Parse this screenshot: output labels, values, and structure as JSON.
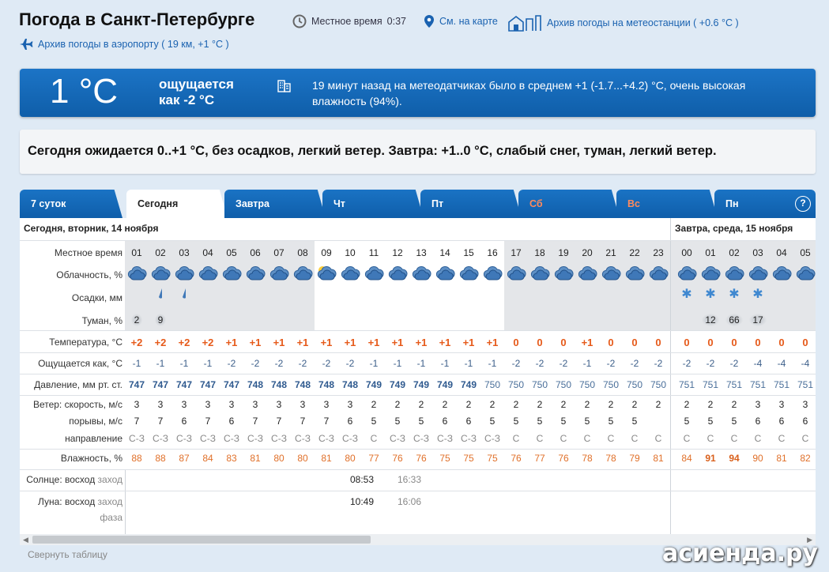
{
  "header": {
    "title": "Погода в Санкт-Петербурге",
    "local_time_label": "Местное время",
    "local_time_value": "0:37",
    "map_link": "См. на карте",
    "station_archive": "Архив погоды на метеостанции ( +0.6 °C )",
    "airport_archive": "Архив погоды в аэропорту ( 19 км, +1 °C )"
  },
  "current": {
    "temp": "1 °C",
    "feels_line1": "ощущается",
    "feels_line2": "как -2 °C",
    "desc": "19 минут назад на метеодатчиках было в среднем +1 (-1.7...+4.2) °C, очень высокая влажность (94%)."
  },
  "forecast_text": "Сегодня ожидается 0..+1 °C, без осадков, легкий ветер. Завтра: +1..0 °C, слабый снег, туман, легкий ветер.",
  "tabs": [
    {
      "label": "7 суток"
    },
    {
      "label": "Сегодня"
    },
    {
      "label": "Завтра"
    },
    {
      "label": "Чт"
    },
    {
      "label": "Пт"
    },
    {
      "label": "Сб"
    },
    {
      "label": "Вс"
    },
    {
      "label": "Пн"
    }
  ],
  "help": "?",
  "table": {
    "day1": "Сегодня, вторник, 14 ноября",
    "day2": "Завтра, среда, 15 ноября",
    "labels": {
      "time": "Местное время",
      "cloud": "Облачность, %",
      "precip": "Осадки, мм",
      "fog": "Туман, %",
      "temp": "Температура, °С",
      "feels": "Ощущается как, °С",
      "pressure": "Давление, мм рт. ст.",
      "wind": "Ветер: скорость, м/с",
      "gusts": "порывы, м/с",
      "direction": "направление",
      "humidity": "Влажность, %",
      "sun": "Солнце:",
      "sunrise": "восход",
      "sunset": "заход",
      "moon": "Луна:",
      "phase": "фаза"
    },
    "hours": [
      "01",
      "02",
      "03",
      "04",
      "05",
      "06",
      "07",
      "08",
      "09",
      "10",
      "11",
      "12",
      "13",
      "14",
      "15",
      "16",
      "17",
      "18",
      "19",
      "20",
      "21",
      "22",
      "23",
      "00",
      "01",
      "02",
      "03",
      "04",
      "05"
    ],
    "fog": [
      "2",
      "9",
      "",
      "",
      "",
      "",
      "",
      "",
      "",
      "",
      "",
      "",
      "",
      "",
      "",
      "",
      "",
      "",
      "",
      "",
      "",
      "",
      "",
      "",
      "12",
      "66",
      "17",
      "",
      ""
    ],
    "temp": [
      "+2",
      "+2",
      "+2",
      "+2",
      "+1",
      "+1",
      "+1",
      "+1",
      "+1",
      "+1",
      "+1",
      "+1",
      "+1",
      "+1",
      "+1",
      "+1",
      "0",
      "0",
      "0",
      "+1",
      "0",
      "0",
      "0",
      "0",
      "0",
      "0",
      "0",
      "0",
      "0"
    ],
    "feels": [
      "-1",
      "-1",
      "-1",
      "-1",
      "-2",
      "-2",
      "-2",
      "-2",
      "-2",
      "-2",
      "-1",
      "-1",
      "-1",
      "-1",
      "-1",
      "-1",
      "-2",
      "-2",
      "-2",
      "-1",
      "-2",
      "-2",
      "-2",
      "-2",
      "-2",
      "-2",
      "-4",
      "-4",
      "-4"
    ],
    "pressure": [
      "747",
      "747",
      "747",
      "747",
      "747",
      "748",
      "748",
      "748",
      "748",
      "748",
      "749",
      "749",
      "749",
      "749",
      "749",
      "750",
      "750",
      "750",
      "750",
      "750",
      "750",
      "750",
      "750",
      "751",
      "751",
      "751",
      "751",
      "751",
      "751"
    ],
    "wind": [
      "3",
      "3",
      "3",
      "3",
      "3",
      "3",
      "3",
      "3",
      "3",
      "3",
      "2",
      "2",
      "2",
      "2",
      "2",
      "2",
      "2",
      "2",
      "2",
      "2",
      "2",
      "2",
      "2",
      "2",
      "2",
      "2",
      "3",
      "3",
      "3"
    ],
    "gusts": [
      "7",
      "7",
      "6",
      "7",
      "6",
      "7",
      "7",
      "7",
      "7",
      "6",
      "5",
      "5",
      "5",
      "6",
      "6",
      "5",
      "5",
      "5",
      "5",
      "5",
      "5",
      "5",
      "",
      "5",
      "5",
      "5",
      "6",
      "6",
      "6"
    ],
    "direction": [
      "С-З",
      "С-З",
      "С-З",
      "С-З",
      "С-З",
      "С-З",
      "С-З",
      "С-З",
      "С-З",
      "С-З",
      "С",
      "С-З",
      "С-З",
      "С-З",
      "С-З",
      "С-З",
      "С",
      "С",
      "С",
      "С",
      "С",
      "С",
      "С",
      "С",
      "С",
      "С",
      "С",
      "С",
      "С"
    ],
    "humidity": [
      "88",
      "88",
      "87",
      "84",
      "83",
      "81",
      "80",
      "80",
      "81",
      "80",
      "77",
      "76",
      "76",
      "75",
      "75",
      "75",
      "76",
      "77",
      "76",
      "78",
      "78",
      "79",
      "81",
      "84",
      "91",
      "94",
      "90",
      "81",
      "82"
    ],
    "sunrise": "08:53",
    "sunset": "16:33",
    "moonrise": "10:49",
    "moonset": "16:06"
  },
  "collapse": "Свернуть таблицу",
  "watermark": "асиенда.ру"
}
